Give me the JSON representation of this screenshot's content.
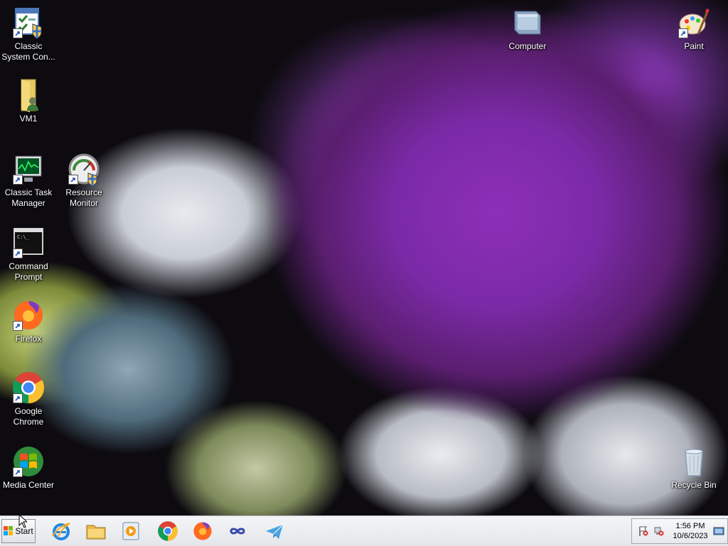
{
  "desktop": {
    "icons": [
      {
        "label": "Classic System Con...",
        "icon": "control-panel-icon"
      },
      {
        "label": "VM1",
        "icon": "user-folder-icon"
      },
      {
        "label": "Classic Task Manager",
        "icon": "task-manager-icon"
      },
      {
        "label": "Resource Monitor",
        "icon": "gauge-icon"
      },
      {
        "label": "Command Prompt",
        "icon": "command-prompt-icon"
      },
      {
        "label": "Firefox",
        "icon": "firefox-icon"
      },
      {
        "label": "Google Chrome",
        "icon": "chrome-icon"
      },
      {
        "label": "Media Center",
        "icon": "windows-logo-icon"
      },
      {
        "label": "Computer",
        "icon": "computer-icon"
      },
      {
        "label": "Paint",
        "icon": "paint-icon"
      },
      {
        "label": "Recycle Bin",
        "icon": "recycle-bin-icon"
      }
    ]
  },
  "taskbar": {
    "start_label": "Start",
    "pinned": [
      {
        "name": "Internet Explorer",
        "icon": "internet-explorer-icon"
      },
      {
        "name": "File Explorer",
        "icon": "folder-icon"
      },
      {
        "name": "Media Player",
        "icon": "media-player-icon"
      },
      {
        "name": "Google Chrome",
        "icon": "chrome-icon"
      },
      {
        "name": "Firefox",
        "icon": "firefox-icon"
      },
      {
        "name": "App",
        "icon": "infinity-icon"
      },
      {
        "name": "Telegram",
        "icon": "paper-plane-icon"
      }
    ],
    "tray": {
      "time": "1:56 PM",
      "date": "10/6/2023"
    }
  },
  "colors": {
    "taskbar_bg": "#eef0f3",
    "label_text": "#ffffff"
  }
}
